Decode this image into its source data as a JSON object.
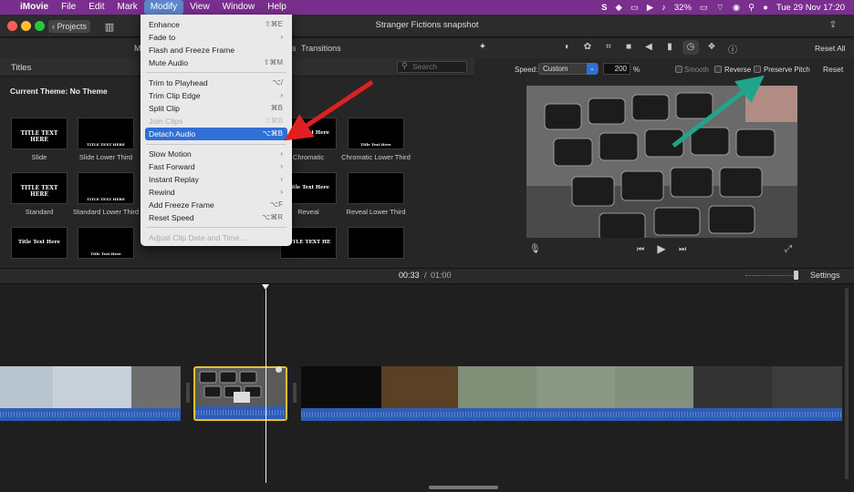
{
  "menubar": {
    "app": "iMovie",
    "items": [
      "File",
      "Edit",
      "Mark",
      "Modify",
      "View",
      "Window",
      "Help"
    ],
    "active_item": "Modify",
    "battery": "32%",
    "datetime": "Tue 29 Nov  17:20"
  },
  "window": {
    "title": "Stranger Fictions snapshot",
    "projects_label": "Projects"
  },
  "browser": {
    "tab_partial": "M",
    "tab_partial2": "s",
    "transitions_label": "Transitions",
    "titles_label": "Titles",
    "search_placeholder": "Search",
    "current_theme": "Current Theme: No Theme",
    "thumbs": [
      {
        "text": "TITLE TEXT HERE",
        "label": "Slide"
      },
      {
        "text": "TITLE TEXT HERE",
        "label": "Slide Lower Third"
      },
      {
        "text": "Title Text Here",
        "label": "Chromatic"
      },
      {
        "text": "Title Text Here",
        "label": "Chromatic Lower Third"
      },
      {
        "text": "TITLE TEXT HERE",
        "label": "Standard"
      },
      {
        "text": "TITLE TEXT HERE",
        "label": "Standard Lower Third"
      },
      {
        "text": "Title Text Here",
        "label": "Reveal"
      },
      {
        "text": "",
        "label": "Reveal Lower Third"
      },
      {
        "text": "Title Text Here",
        "label": ""
      },
      {
        "text": "Title Text Here",
        "label": ""
      },
      {
        "text": "TITLE TEXT HE",
        "label": ""
      },
      {
        "text": "",
        "label": ""
      }
    ]
  },
  "menu": {
    "items": [
      {
        "label": "Enhance",
        "shortcut": "⇧⌘E",
        "enabled": true
      },
      {
        "label": "Fade to",
        "shortcut": "›",
        "enabled": true
      },
      {
        "label": "Flash and Freeze Frame",
        "shortcut": "",
        "enabled": true
      },
      {
        "label": "Mute Audio",
        "shortcut": "⇧⌘M",
        "enabled": true
      },
      {
        "label": "Trim to Playhead",
        "shortcut": "⌥/",
        "enabled": true
      },
      {
        "label": "Trim Clip Edge",
        "shortcut": "›",
        "enabled": true
      },
      {
        "label": "Split Clip",
        "shortcut": "⌘B",
        "enabled": true
      },
      {
        "label": "Join Clips",
        "shortcut": "⇧⌘B",
        "enabled": false
      },
      {
        "label": "Detach Audio",
        "shortcut": "⌥⌘B",
        "enabled": true,
        "selected": true
      },
      {
        "label": "Slow Motion",
        "shortcut": "›",
        "enabled": true
      },
      {
        "label": "Fast Forward",
        "shortcut": "›",
        "enabled": true
      },
      {
        "label": "Instant Replay",
        "shortcut": "›",
        "enabled": true
      },
      {
        "label": "Rewind",
        "shortcut": "›",
        "enabled": true
      },
      {
        "label": "Add Freeze Frame",
        "shortcut": "⌥F",
        "enabled": true
      },
      {
        "label": "Reset Speed",
        "shortcut": "⌥⌘R",
        "enabled": true
      },
      {
        "label": "Adjust Clip Date and Time...",
        "shortcut": "",
        "enabled": false
      }
    ]
  },
  "inspector": {
    "reset_all": "Reset All",
    "speed_label": "Speed:",
    "speed_value": "Custom",
    "speed_percent": "200",
    "percent_sign": "%",
    "smooth": "Smooth",
    "reverse": "Reverse",
    "preserve_pitch": "Preserve Pitch",
    "reset": "Reset"
  },
  "timeline": {
    "current_time": "00:33",
    "separator": "/",
    "total_time": "01:00",
    "settings_label": "Settings"
  },
  "colors": {
    "menubar": "#7a2e8e",
    "selection": "#2f6fd6",
    "clip_selected_border": "#e8c12a",
    "audio_wave": "#2f5db5",
    "arrow_red": "#e02020",
    "arrow_teal": "#1fa68a"
  }
}
